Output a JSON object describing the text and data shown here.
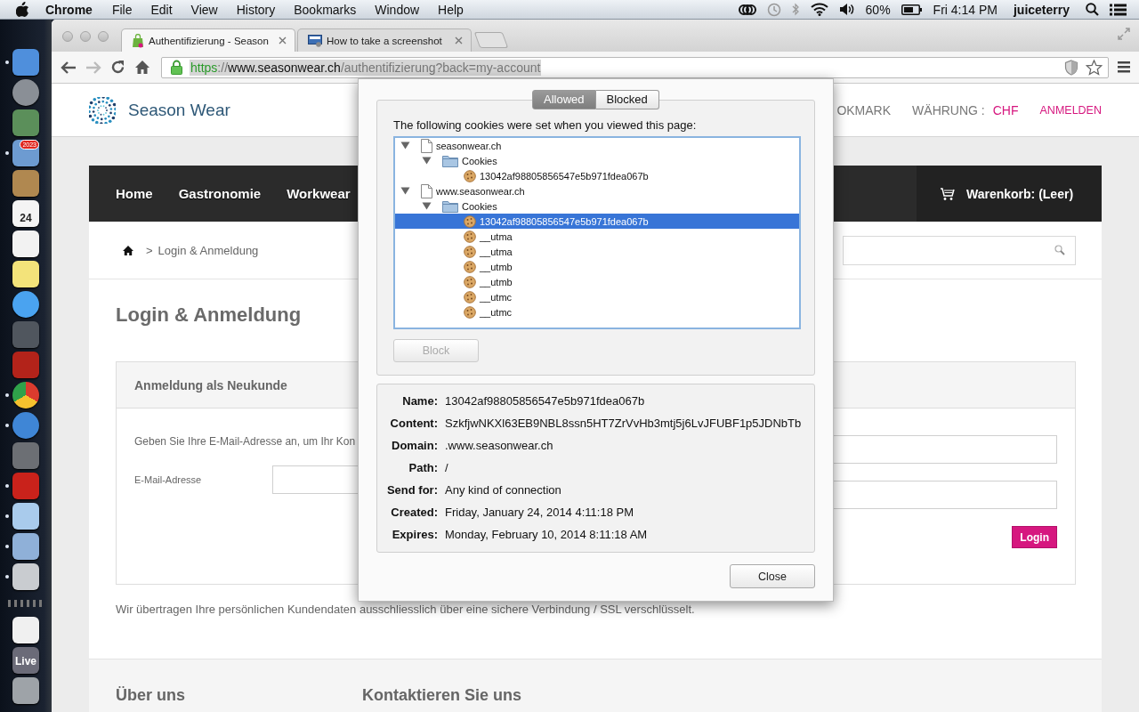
{
  "menubar": {
    "app": "Chrome",
    "menus": [
      "File",
      "Edit",
      "View",
      "History",
      "Bookmarks",
      "Window",
      "Help"
    ],
    "battery": "60%",
    "clock": "Fri 4:14 PM",
    "user": "juiceterry"
  },
  "dock": {
    "items": [
      {
        "kind": "finder",
        "running": true
      },
      {
        "kind": "launchpad",
        "running": false
      },
      {
        "kind": "cards",
        "running": false
      },
      {
        "kind": "mail",
        "running": true,
        "badge": "2023"
      },
      {
        "kind": "contacts",
        "running": false
      },
      {
        "kind": "calendar",
        "running": false,
        "label": "24"
      },
      {
        "kind": "list",
        "running": false
      },
      {
        "kind": "notes",
        "running": false
      },
      {
        "kind": "chat",
        "running": false
      },
      {
        "kind": "camera",
        "running": false
      },
      {
        "kind": "curtain",
        "running": false
      },
      {
        "kind": "chrome",
        "running": true
      },
      {
        "kind": "music",
        "running": true
      },
      {
        "kind": "gear",
        "running": false
      },
      {
        "kind": "ftp",
        "running": true
      },
      {
        "kind": "cube",
        "running": true
      },
      {
        "kind": "photos",
        "running": true
      },
      {
        "kind": "calculator",
        "running": true
      }
    ],
    "extras": [
      {
        "kind": "document",
        "running": false
      },
      {
        "kind": "folder",
        "running": false,
        "label": "Live"
      },
      {
        "kind": "trash",
        "running": false
      }
    ]
  },
  "tabs": [
    {
      "title": "Authentifizierung - Season",
      "selected": true,
      "kind": "shop"
    },
    {
      "title": "How to take a screenshot",
      "selected": false,
      "kind": "screen"
    }
  ],
  "toolbar": {
    "back": {
      "disabled": false
    },
    "forward": {
      "disabled": true
    }
  },
  "address": {
    "scheme": "https",
    "separator": "://",
    "host": "www.seasonwear.ch",
    "path": "/authentifizierung?back=my-account",
    "selected": true
  },
  "page": {
    "logo": "Season Wear",
    "header_links": [
      {
        "label": "OKMARK",
        "kind": "link"
      },
      {
        "label": "WÄHRUNG :",
        "kind": "label"
      },
      {
        "label": "CHF",
        "kind": "value"
      },
      {
        "label": "ANMELDEN",
        "kind": "accent"
      }
    ],
    "nav": [
      "Home",
      "Gastronomie",
      "Workwear"
    ],
    "cart": "Warenkorb: (Leer)",
    "breadcrumb": {
      "separator": ">",
      "current": "Login & Anmeldung"
    },
    "heading": "Login & Anmeldung",
    "panel": {
      "title": "Anmeldung als Neukunde",
      "intro": "Geben Sie Ihre E-Mail-Adresse an, um Ihr Kon",
      "email_label": "E-Mail-Adresse",
      "login_button": "Login"
    },
    "notice": "Wir übertragen Ihre persönlichen Kundendaten ausschliesslich über eine sichere Verbindung / SSL verschlüsselt.",
    "footer": [
      "Über uns",
      "Kontaktieren Sie uns"
    ]
  },
  "dialog": {
    "segments": [
      {
        "label": "Allowed",
        "selected": true
      },
      {
        "label": "Blocked",
        "selected": false
      }
    ],
    "intro": "The following cookies were set when you viewed this page:",
    "tree": [
      {
        "kind": "site",
        "label": "seasonwear.ch",
        "expanded": true,
        "selected": false,
        "children": [
          {
            "kind": "folder",
            "label": "Cookies",
            "expanded": true,
            "selected": false,
            "children": [
              {
                "kind": "cookie",
                "label": "13042af98805856547e5b971fdea067b",
                "selected": false
              }
            ]
          }
        ]
      },
      {
        "kind": "site",
        "label": "www.seasonwear.ch",
        "expanded": true,
        "selected": false,
        "children": [
          {
            "kind": "folder",
            "label": "Cookies",
            "expanded": true,
            "selected": false,
            "children": [
              {
                "kind": "cookie",
                "label": "13042af98805856547e5b971fdea067b",
                "selected": true
              },
              {
                "kind": "cookie",
                "label": "__utma",
                "selected": false
              },
              {
                "kind": "cookie",
                "label": "__utma",
                "selected": false
              },
              {
                "kind": "cookie",
                "label": "__utmb",
                "selected": false
              },
              {
                "kind": "cookie",
                "label": "__utmb",
                "selected": false
              },
              {
                "kind": "cookie",
                "label": "__utmc",
                "selected": false
              },
              {
                "kind": "cookie",
                "label": "__utmc",
                "selected": false
              }
            ]
          }
        ]
      }
    ],
    "block_button": {
      "label": "Block",
      "disabled": true
    },
    "details": [
      {
        "label": "Name:",
        "value": "13042af98805856547e5b971fdea067b"
      },
      {
        "label": "Content:",
        "value": "SzkfjwNKXl63EB9NBL8ssn5HT7ZrVvHb3mtj5j6LvJFUBF1p5JDNbTb"
      },
      {
        "label": "Domain:",
        "value": ".www.seasonwear.ch"
      },
      {
        "label": "Path:",
        "value": "/"
      },
      {
        "label": "Send for:",
        "value": "Any kind of connection"
      },
      {
        "label": "Created:",
        "value": "Friday, January 24, 2014 4:11:18 PM"
      },
      {
        "label": "Expires:",
        "value": "Monday, February 10, 2014 8:11:18 AM"
      }
    ],
    "close_button": "Close"
  }
}
